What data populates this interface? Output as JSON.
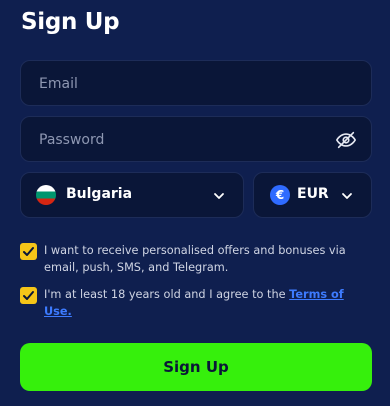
{
  "page": {
    "title": "Sign Up"
  },
  "form": {
    "email_placeholder": "Email",
    "password_placeholder": "Password",
    "country": {
      "selected": "Bulgaria",
      "flag": "bulgaria-flag"
    },
    "currency": {
      "selected": "EUR",
      "symbol": "€"
    },
    "consents": [
      {
        "checked": true,
        "text": "I want to receive personalised offers and bonuses via email, push, SMS, and Telegram."
      },
      {
        "checked": true,
        "text": "I'm at least 18 years old and I agree to the ",
        "link_text": "Terms of Use."
      }
    ],
    "submit_label": "Sign Up"
  },
  "icons": {
    "password_toggle": "eye-slash-icon",
    "dropdown": "chevron-down-icon",
    "checkbox": "checkmark-icon"
  },
  "colors": {
    "background": "#0f1f4f",
    "field_bg": "#0a1638",
    "accent_green": "#36f00c",
    "checkbox_yellow": "#f5c518",
    "link_blue": "#3d7bff",
    "currency_blue": "#2f6bff"
  }
}
